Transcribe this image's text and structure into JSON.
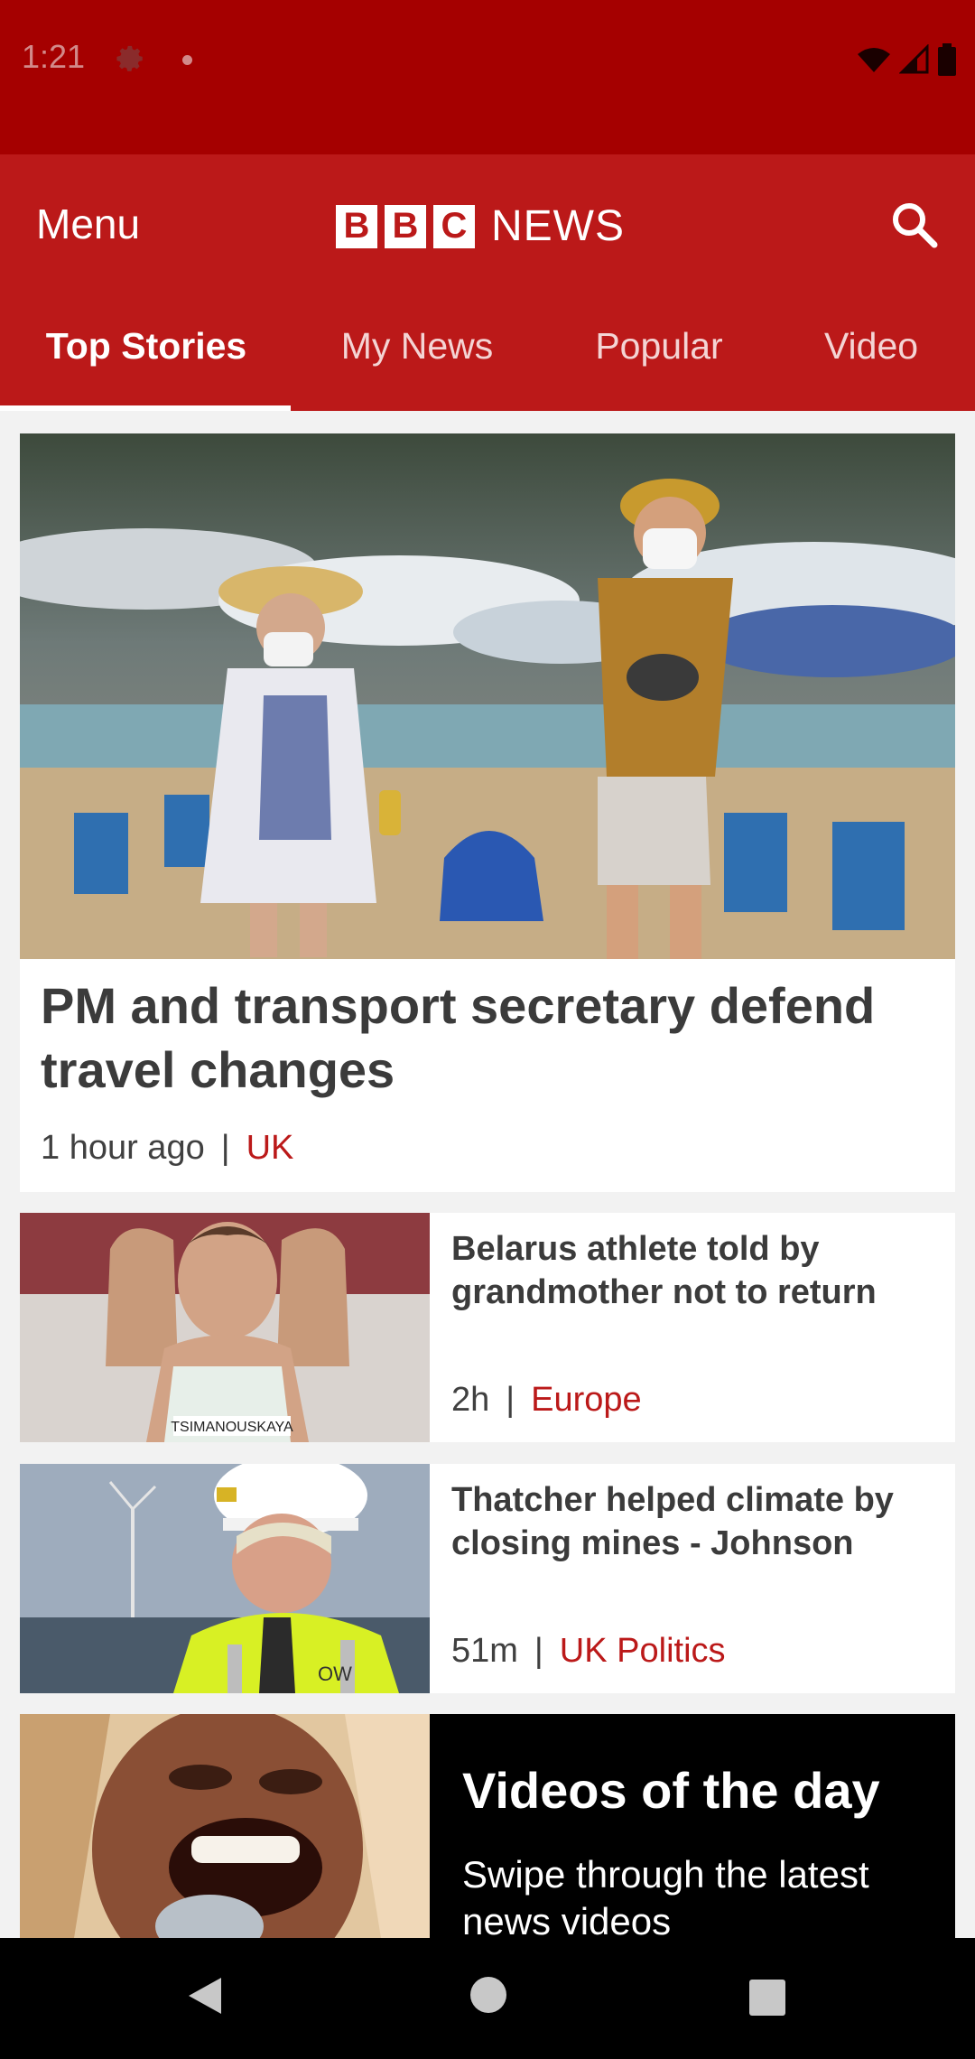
{
  "status_bar": {
    "time": "1:21",
    "icons": [
      "gear-icon",
      "dot",
      "wifi-icon",
      "signal-icon",
      "battery-icon"
    ]
  },
  "app_bar": {
    "menu_label": "Menu",
    "logo": {
      "letters": [
        "B",
        "B",
        "C"
      ],
      "word": "NEWS"
    },
    "search_icon": "search-icon"
  },
  "tabs": [
    {
      "label": "Top Stories",
      "active": true
    },
    {
      "label": "My News"
    },
    {
      "label": "Popular"
    },
    {
      "label": "Video"
    }
  ],
  "stories": {
    "lead": {
      "headline": "PM and transport secretary defend travel changes",
      "time": "1 hour ago",
      "category": "UK"
    },
    "items": [
      {
        "headline": "Belarus athlete told by grandmother not to return",
        "time": "2h",
        "category": "Europe",
        "thumb_text": "TSIMANOUSKAYA"
      },
      {
        "headline": "Thatcher helped climate by closing mines - Johnson",
        "time": "51m",
        "category": "UK Politics",
        "thumb_text": "OW"
      }
    ],
    "promo": {
      "title": "Videos of the day",
      "subtitle": "Swipe through the latest news videos"
    }
  },
  "colors": {
    "brand_red": "#bb1919",
    "status_red": "#a50000",
    "text_dark": "#3b3b3b"
  }
}
